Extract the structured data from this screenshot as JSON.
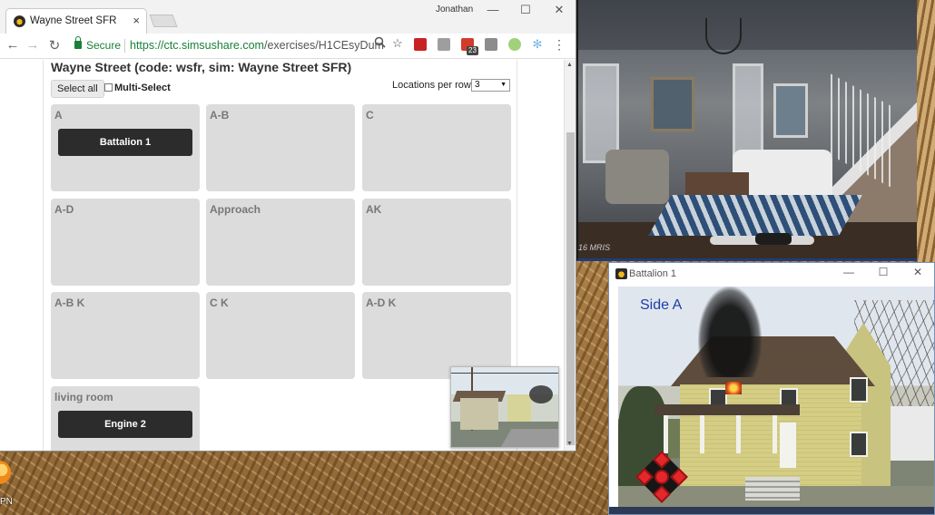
{
  "desktop": {
    "icon_label": "PN"
  },
  "browser": {
    "tab_title": "Wayne Street SFR",
    "tab_close": "×",
    "profile_name": "Jonathan",
    "window_controls": {
      "minimize": "—",
      "maximize": "☐",
      "close": "✕"
    },
    "nav": {
      "back": "←",
      "forward": "→",
      "reload": "↻"
    },
    "secure_label": "Secure",
    "url_scheme_host": "https://ctc.simsushare.com",
    "url_path": "/exercises/H1CEsyDum",
    "extension_badge": "23",
    "menu": "⋮"
  },
  "page": {
    "title": "Wayne Street (code: wsfr, sim: Wayne Street SFR)",
    "select_all_label": "Select all",
    "multi_select_label": "Multi-Select",
    "locations_per_row_label": "Locations per row:",
    "locations_per_row_value": "3",
    "locations": [
      {
        "name": "A",
        "units": [
          "Battalion 1"
        ]
      },
      {
        "name": "A-B",
        "units": []
      },
      {
        "name": "C",
        "units": []
      },
      {
        "name": "A-D",
        "units": []
      },
      {
        "name": "Approach",
        "units": []
      },
      {
        "name": "AK",
        "units": []
      },
      {
        "name": "A-B K",
        "units": []
      },
      {
        "name": "C K",
        "units": []
      },
      {
        "name": "A-D K",
        "units": []
      },
      {
        "name": "living room",
        "units": [
          "Engine 2"
        ]
      }
    ]
  },
  "room_image": {
    "credit": "16 MRIS"
  },
  "battalion_window": {
    "title": "Battalion 1",
    "window_controls": {
      "minimize": "—",
      "maximize": "☐",
      "close": "✕"
    },
    "scene_label": "Side A"
  },
  "colors": {
    "secure_green": "#188038",
    "unit_button": "#2c2c2c",
    "location_cell": "#dcdcdc",
    "side_label_blue": "#1f3ea8",
    "control_red": "#e3272b"
  }
}
